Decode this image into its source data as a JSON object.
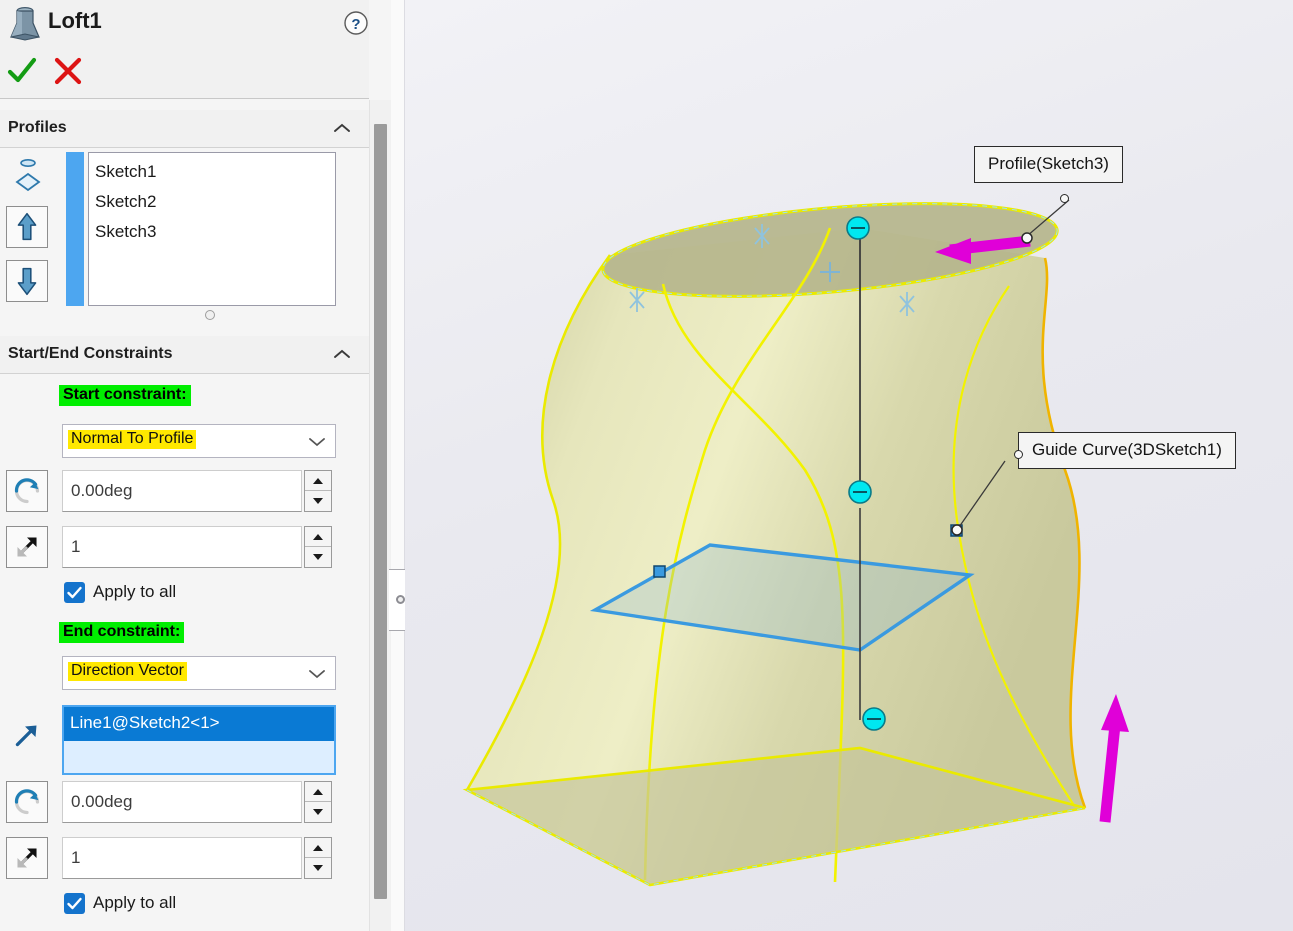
{
  "panel": {
    "title": "Loft1",
    "icons": {
      "feature": "loft-icon",
      "help": "help-icon",
      "accept": "ok-checkmark-icon",
      "cancel": "cancel-x-icon"
    },
    "profiles": {
      "heading": "Profiles",
      "items": [
        "Sketch1",
        "Sketch2",
        "Sketch3"
      ],
      "move_up_label": "Move Up",
      "move_down_label": "Move Down"
    },
    "constraints": {
      "heading": "Start/End Constraints",
      "start": {
        "label": "Start constraint:",
        "value": "Normal To Profile",
        "tangent_length": "0.00deg",
        "tangent_factor": "1",
        "apply_to_all": "Apply to all",
        "apply_to_all_checked": true
      },
      "end": {
        "label": "End constraint:",
        "value": "Direction Vector",
        "selection": "Line1@Sketch2<1>",
        "tangent_length": "0.00deg",
        "tangent_factor": "1",
        "apply_to_all": "Apply to all",
        "apply_to_all_checked": true
      }
    }
  },
  "viewport": {
    "callouts": [
      {
        "text": "Profile(Sketch3)"
      },
      {
        "text": "Guide Curve(3DSketch1)"
      }
    ]
  },
  "colors": {
    "highlight_green": "#00ee00",
    "highlight_yellow": "#ffe800",
    "accent_blue": "#4da6f0",
    "selection_blue": "#0a7ad4",
    "surface_khaki": "#c5c59a",
    "surface_light": "#e8e8b8",
    "edge_yellow": "#f2f200",
    "sketch_blue": "#3a9ae0",
    "point_cyan": "#00e8f0",
    "arrow_magenta": "#e000d8",
    "viewport_bg": "#e9e9ef"
  }
}
